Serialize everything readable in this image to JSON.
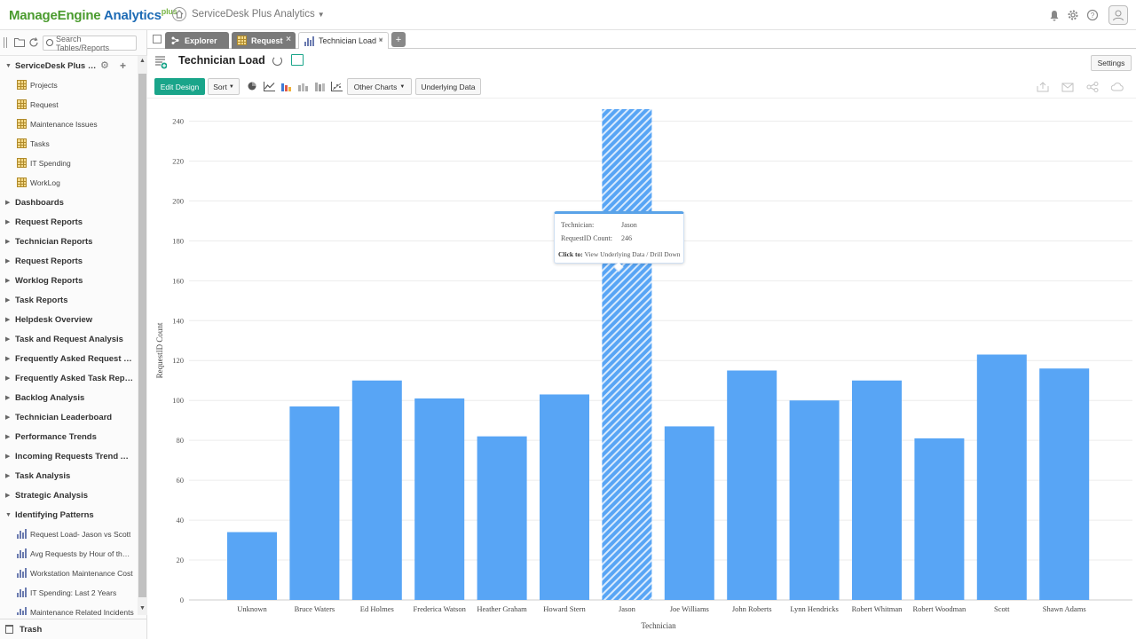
{
  "header": {
    "logo_brand": "ManageEngine",
    "logo_product": "Analytics",
    "logo_suffix": "plus",
    "workspace_title": "ServiceDesk Plus Analytics"
  },
  "tabs": [
    {
      "label": "Explorer"
    },
    {
      "label": "Request"
    },
    {
      "label": "Technician Load"
    }
  ],
  "sidebar": {
    "search_placeholder": "Search Tables/Reports",
    "root": "ServiceDesk Plus Da...",
    "tables": [
      "Projects",
      "Request",
      "Maintenance Issues",
      "Tasks",
      "IT Spending",
      "WorkLog"
    ],
    "folders": [
      "Dashboards",
      "Request Reports",
      "Technician Reports",
      "Request Reports",
      "Worklog Reports",
      "Task Reports",
      "Helpdesk Overview",
      "Task and Request Analysis",
      "Frequently Asked Request Re...",
      "Frequently Asked Task Reports",
      "Backlog Analysis",
      "Technician Leaderboard",
      "Performance Trends",
      "Incoming Requests Trend An...",
      "Task Analysis",
      "Strategic Analysis",
      "Identifying Patterns"
    ],
    "pattern_items": [
      "Request Load- Jason vs Scott",
      "Avg Requests by Hour of the ...",
      "Workstation Maintenance Cost",
      "IT Spending: Last 2 Years",
      "Maintenance Related Incidents"
    ],
    "trash": "Trash"
  },
  "report": {
    "title": "Technician Load",
    "settings_label": "Settings"
  },
  "toolbar": {
    "edit_design": "Edit Design",
    "sort": "Sort",
    "other_charts": "Other Charts",
    "underlying_data": "Underlying Data"
  },
  "tooltip": {
    "technician_label": "Technician:",
    "technician_value": "Jason",
    "count_label": "RequestID Count:",
    "count_value": "246",
    "click_label": "Click to:",
    "click_text": "View Underlying Data / Drill Down"
  },
  "colors": {
    "bar": "#58a5f5",
    "accent": "#1aa58a"
  },
  "chart_data": {
    "type": "bar",
    "categories": [
      "Unknown",
      "Bruce Waters",
      "Ed Holmes",
      "Frederica Watson",
      "Heather Graham",
      "Howard Stern",
      "Jason",
      "Joe Williams",
      "John Roberts",
      "Lynn Hendricks",
      "Robert Whitman",
      "Robert Woodman",
      "Scott",
      "Shawn Adams"
    ],
    "values": [
      34,
      97,
      110,
      101,
      82,
      103,
      246,
      87,
      115,
      100,
      110,
      81,
      123,
      116
    ],
    "highlighted": "Jason",
    "xlabel": "Technician",
    "ylabel": "RequestID Count",
    "ylim": [
      0,
      250
    ],
    "yticks": [
      0,
      20,
      40,
      60,
      80,
      100,
      120,
      140,
      160,
      180,
      200,
      220,
      240
    ],
    "grid": true,
    "legend": "none"
  }
}
